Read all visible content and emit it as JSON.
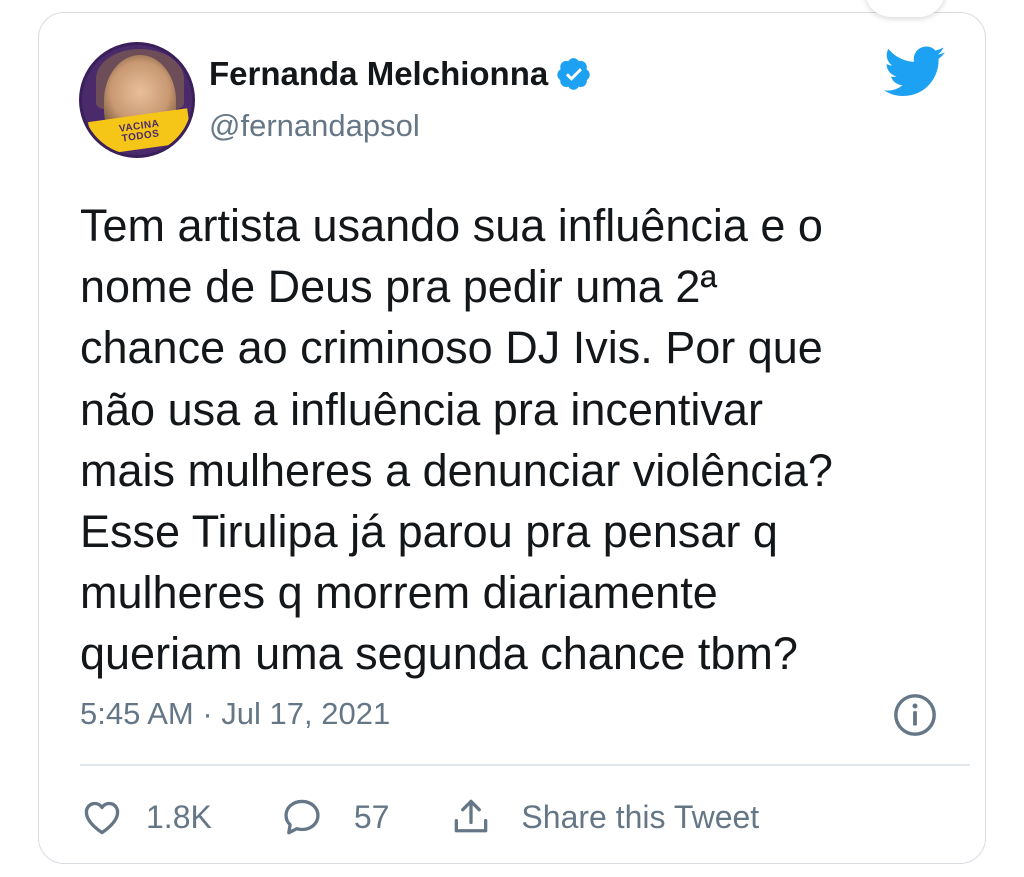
{
  "author": {
    "name": "Fernanda Melchionna",
    "handle": "@fernandapsol",
    "avatar_banner": [
      "VACINA",
      "TODOS"
    ],
    "verified": true
  },
  "tweet": {
    "lines": [
      "Tem artista usando sua influência e o",
      "nome de Deus pra pedir uma 2ª",
      "chance ao criminoso DJ Ivis. Por que",
      "não usa a influência pra incentivar",
      "mais mulheres a denunciar violência?",
      "Esse Tirulipa já parou pra pensar q",
      "mulheres q morrem diariamente",
      "queriam uma segunda chance tbm?"
    ],
    "timestamp": "5:45 AM · Jul 17, 2021"
  },
  "actions": {
    "like_count": "1.8K",
    "reply_count": "57",
    "share_label": "Share this Tweet"
  },
  "icons": {
    "brand": "twitter-bird-icon",
    "verified": "verified-badge-icon",
    "info": "info-icon",
    "like": "heart-icon",
    "reply": "reply-bubble-icon",
    "share": "share-icon"
  },
  "colors": {
    "twitter_blue": "#1da1f2",
    "text_primary": "#14171a",
    "text_secondary": "#657786",
    "border": "#d8dde2"
  }
}
